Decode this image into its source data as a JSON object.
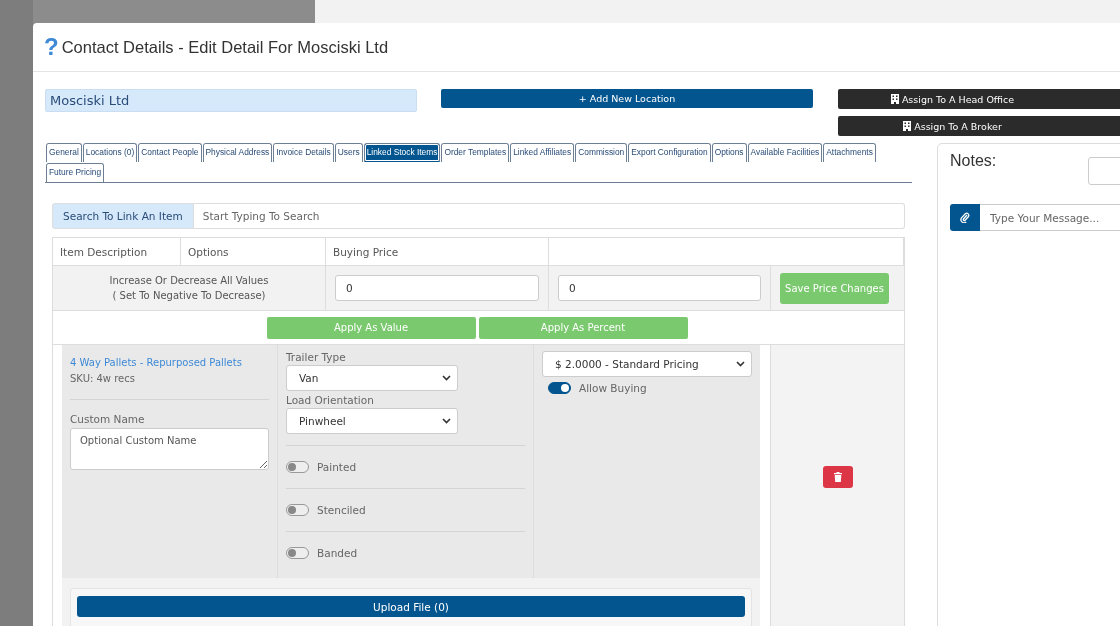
{
  "dialog": {
    "help_icon": "?",
    "title": "Contact Details - Edit Detail For Mosciski Ltd"
  },
  "name_field": {
    "value": "Mosciski Ltd"
  },
  "add_location_button": {
    "icon": "+",
    "label": "Add New Location"
  },
  "assign_buttons": [
    {
      "label": "Assign To A Head Office"
    },
    {
      "label": "Assign To A Broker"
    }
  ],
  "tabs": [
    {
      "label": "General",
      "selected": false
    },
    {
      "label": "Locations (0)",
      "selected": false
    },
    {
      "label": "Contact People",
      "selected": false
    },
    {
      "label": "Physical Address",
      "selected": false
    },
    {
      "label": "Invoice Details",
      "selected": false
    },
    {
      "label": "Users",
      "selected": false
    },
    {
      "label": "Linked Stock Items",
      "selected": true
    },
    {
      "label": "Order Templates",
      "selected": false
    },
    {
      "label": "Linked Affiliates",
      "selected": false
    },
    {
      "label": "Commission",
      "selected": false
    },
    {
      "label": "Export Configuration",
      "selected": false
    },
    {
      "label": "Options",
      "selected": false
    },
    {
      "label": "Available Facilities",
      "selected": false
    },
    {
      "label": "Attachments",
      "selected": false
    },
    {
      "label": "Future Pricing",
      "selected": false
    }
  ],
  "search": {
    "label": "Search To Link An Item",
    "placeholder": "Start Typing To Search"
  },
  "table": {
    "columns": [
      "Item Description",
      "Options",
      "Buying Price"
    ],
    "bulk_row": {
      "label_lines": [
        "Increase Or Decrease All Values",
        "( Set To Negative To Decrease)"
      ],
      "inputs": [
        "0",
        "0"
      ],
      "save_button": "Save Price Changes"
    },
    "apply_buttons": [
      "Apply As Value",
      "Apply As Percent"
    ],
    "item": {
      "name": "4 Way Pallets - Repurposed Pallets",
      "sku": "SKU: 4w recs",
      "custom_name_label": "Custom Name",
      "custom_name_placeholder": "Optional Custom Name",
      "options": [
        {
          "kind": "select",
          "label": "Trailer Type",
          "value": "Van"
        },
        {
          "kind": "select",
          "label": "Load Orientation",
          "value": "Pinwheel"
        },
        {
          "kind": "toggle",
          "label": "Painted",
          "on": false
        },
        {
          "kind": "toggle",
          "label": "Stenciled",
          "on": false
        },
        {
          "kind": "toggle",
          "label": "Banded",
          "on": false
        }
      ],
      "price_select": "$ 2.0000 - Standard Pricing",
      "allow_buying": {
        "label": "Allow Buying",
        "on": true
      },
      "upload_button": "Upload File (0)"
    }
  },
  "notes": {
    "title": "Notes:",
    "message_placeholder": "Type Your Message..."
  }
}
